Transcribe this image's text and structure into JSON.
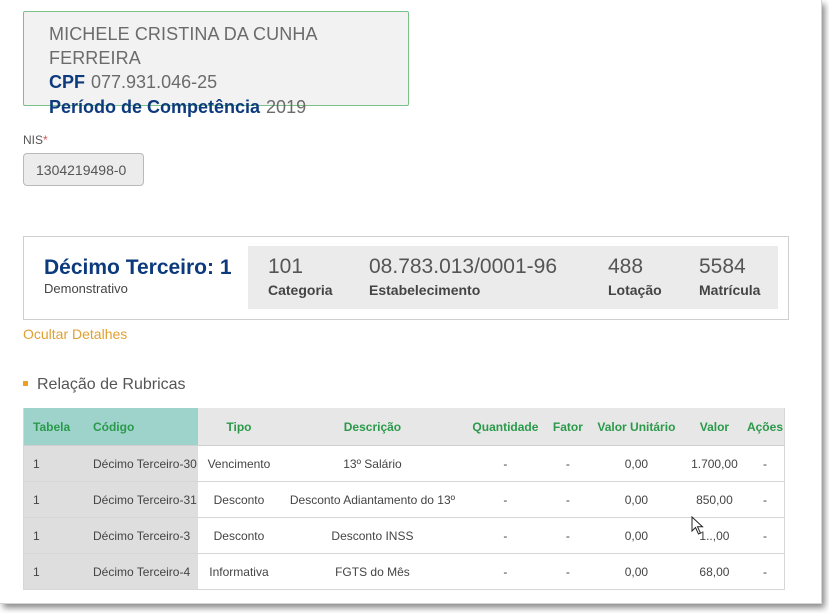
{
  "person": {
    "name": "MICHELE CRISTINA DA CUNHA FERREIRA",
    "cpf_label": "CPF",
    "cpf": "077.931.046-25",
    "periodo_label": "Período de Competência",
    "periodo": "2019"
  },
  "nis": {
    "label": "NIS",
    "required_mark": "*",
    "value": "1304219498-0"
  },
  "summary": {
    "title": "Décimo Terceiro: 1",
    "subtitle": "Demonstrativo",
    "categoria_value": "101",
    "categoria_label": "Categoria",
    "estabelecimento_value": "08.783.013/0001-96",
    "estabelecimento_label": "Estabelecimento",
    "lotacao_value": "488",
    "lotacao_label": "Lotação",
    "matricula_value": "5584",
    "matricula_label": "Matrícula"
  },
  "hide_details_link": "Ocultar Detalhes",
  "section_title": "Relação de Rubricas",
  "table": {
    "headers": [
      "Tabela",
      "Código",
      "Tipo",
      "Descrição",
      "Quantidade",
      "Fator",
      "Valor Unitário",
      "Valor",
      "Ações"
    ],
    "rows": [
      [
        "1",
        "Décimo Terceiro-30",
        "Vencimento",
        "13º Salário",
        "-",
        "-",
        "0,00",
        "1.700,00",
        "-"
      ],
      [
        "1",
        "Décimo Terceiro-31",
        "Desconto",
        "Desconto Adiantamento do 13º",
        "-",
        "-",
        "0,00",
        "850,00",
        "-"
      ],
      [
        "1",
        "Décimo Terceiro-3",
        "Desconto",
        "Desconto INSS",
        "-",
        "-",
        "0,00",
        "1..,00",
        "-"
      ],
      [
        "1",
        "Décimo Terceiro-4",
        "Informativa",
        "FGTS do Mês",
        "-",
        "-",
        "0,00",
        "68,00",
        "-"
      ]
    ]
  },
  "colors": {
    "navy": "#0d3a7d",
    "green_header": "#2a9a4a",
    "teal_header": "#9ed3cc",
    "orange_link": "#e0a030"
  }
}
